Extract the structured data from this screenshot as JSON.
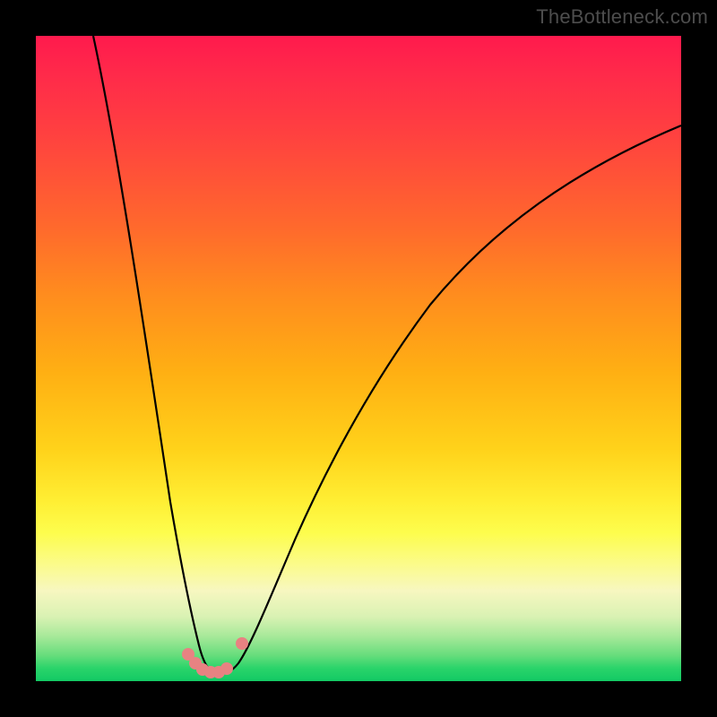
{
  "watermark": "TheBottleneck.com",
  "chart_data": {
    "type": "line",
    "title": "",
    "xlabel": "",
    "ylabel": "",
    "xlim": [
      0,
      100
    ],
    "ylim": [
      0,
      100
    ],
    "grid": false,
    "legend": false,
    "series": [
      {
        "name": "bottleneck-curve",
        "x": [
          9,
          12,
          15,
          18,
          20,
          22,
          24,
          25,
          26,
          27,
          28,
          30,
          33,
          38,
          45,
          55,
          65,
          75,
          85,
          95,
          100
        ],
        "values": [
          100,
          82,
          62,
          42,
          27,
          16,
          8,
          4,
          2,
          1.5,
          2,
          4,
          10,
          22,
          38,
          55,
          66,
          74,
          80,
          84,
          86
        ]
      }
    ],
    "markers": {
      "name": "trough-points",
      "x": [
        23.5,
        24.5,
        25.5,
        26.5,
        27.5,
        28.5,
        31.0
      ],
      "values": [
        4.2,
        2.6,
        1.8,
        1.6,
        1.8,
        2.6,
        6.0
      ]
    },
    "background_gradient_stops": [
      {
        "pos": 0,
        "color": "#ff1a4d"
      },
      {
        "pos": 15,
        "color": "#ff4040"
      },
      {
        "pos": 40,
        "color": "#ff8c1e"
      },
      {
        "pos": 64,
        "color": "#ffd21a"
      },
      {
        "pos": 82,
        "color": "#fbfb8c"
      },
      {
        "pos": 93,
        "color": "#a8e99a"
      },
      {
        "pos": 100,
        "color": "#13c964"
      }
    ],
    "curve_color": "#000000",
    "marker_color": "#e88282"
  }
}
